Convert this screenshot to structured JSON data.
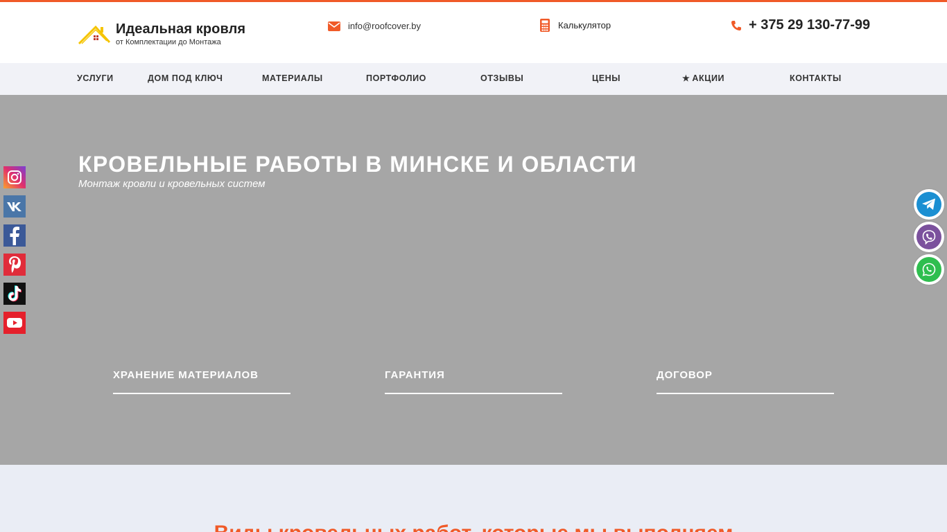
{
  "brand": {
    "name": "Идеальная кровля",
    "tagline": "от Комплектации до Монтажа",
    "accent": "#f05a28",
    "logo_color": "#f5c400"
  },
  "header": {
    "email": "info@roofcover.by",
    "calculator": "Калькулятор",
    "phone": "+ 375 29 130-77-99"
  },
  "nav": {
    "items": [
      {
        "label": "УСЛУГИ"
      },
      {
        "label": "ДОМ ПОД КЛЮЧ"
      },
      {
        "label": "МАТЕРИАЛЫ"
      },
      {
        "label": "ПОРТФОЛИО"
      },
      {
        "label": "ОТЗЫВЫ"
      },
      {
        "label": "ЦЕНЫ"
      },
      {
        "label": "АКЦИИ",
        "icon": "star-icon"
      },
      {
        "label": "КОНТАКТЫ"
      }
    ]
  },
  "hero": {
    "title": "КРОВЕЛЬНЫЕ РАБОТЫ В МИНСКЕ И ОБЛАСТИ",
    "subtitle": "Монтаж кровли и кровельных систем",
    "background": "#a6a6a6",
    "features": [
      {
        "label": "ХРАНЕНИЕ МАТЕРИАЛОВ"
      },
      {
        "label": "ГАРАНТИЯ"
      },
      {
        "label": "ДОГОВОР"
      }
    ]
  },
  "section": {
    "title": "Виды кровельных работ, которые мы выполняем"
  },
  "social": [
    {
      "icon": "instagram-icon"
    },
    {
      "icon": "vk-icon"
    },
    {
      "icon": "facebook-icon"
    },
    {
      "icon": "pinterest-icon"
    },
    {
      "icon": "tiktok-icon"
    },
    {
      "icon": "youtube-icon"
    }
  ],
  "messengers": [
    {
      "icon": "telegram-icon",
      "color": "#1b8fd2"
    },
    {
      "icon": "viber-icon",
      "color": "#7b519d"
    },
    {
      "icon": "whatsapp-icon",
      "color": "#2fbe4f"
    }
  ]
}
